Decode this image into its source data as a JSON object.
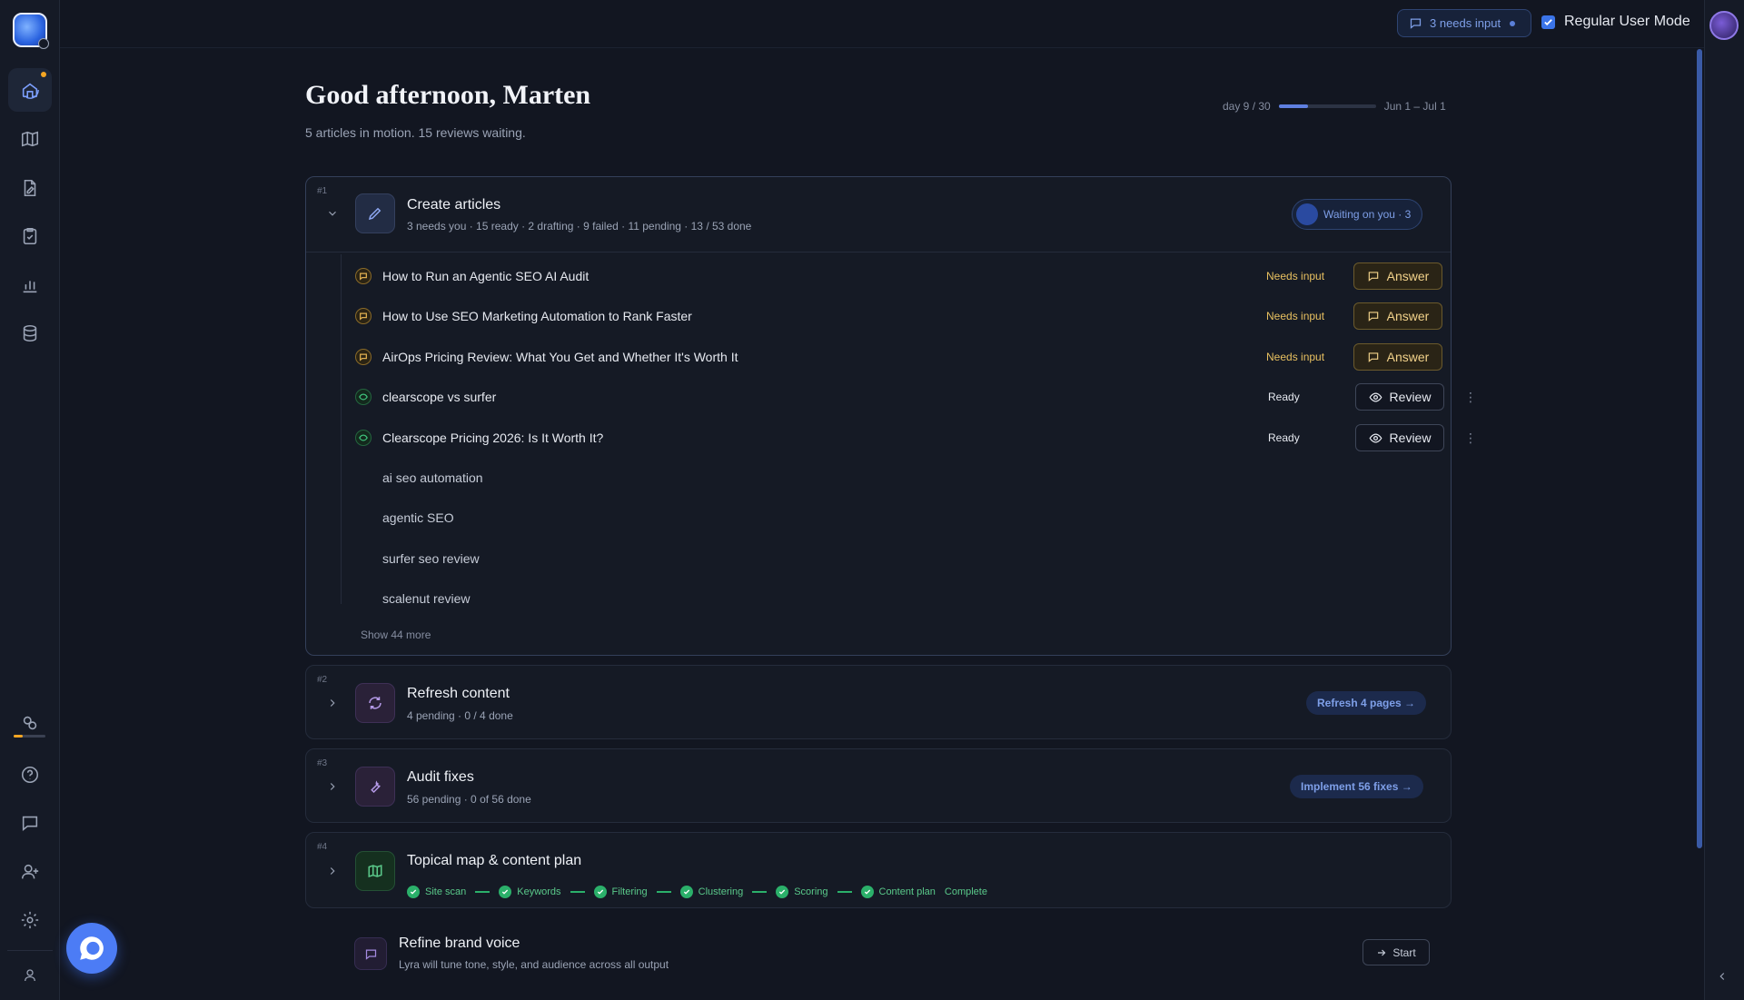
{
  "topbar": {
    "needs_input_label": "3 needs input",
    "mode_label": "Regular User Mode"
  },
  "main": {
    "greeting": "Good afternoon, Marten",
    "subtitle": "5 articles in motion. 15 reviews waiting.",
    "day_label": "day 9 / 30",
    "day_progress": 0.3,
    "date_range": "Jun 1 – Jul 1"
  },
  "cards": {
    "create": {
      "num": "#1",
      "title": "Create articles",
      "meta": "3 needs you · 15 ready · 2 drafting · 9 failed · 11 pending · 13 / 53 done",
      "badge": "Waiting on you · 3",
      "rows": [
        {
          "title": "How to Run an Agentic SEO AI Audit",
          "status": "Needs input",
          "action": "Answer"
        },
        {
          "title": "How to Use SEO Marketing Automation to Rank Faster",
          "status": "Needs input",
          "action": "Answer"
        },
        {
          "title": "AirOps Pricing Review: What You Get and Whether It's Worth It",
          "status": "Needs input",
          "action": "Answer"
        },
        {
          "title": "clearscope vs surfer",
          "status": "Ready",
          "action": "Review"
        },
        {
          "title": "Clearscope Pricing 2026: Is It Worth It?",
          "status": "Ready",
          "action": "Review"
        }
      ],
      "pending": [
        "ai seo automation",
        "agentic SEO",
        "surfer seo review",
        "scalenut review"
      ],
      "show_more": "Show 44 more"
    },
    "refresh": {
      "num": "#2",
      "title": "Refresh content",
      "meta": "4 pending · 0 / 4 done",
      "action": "Refresh 4 pages →"
    },
    "audit": {
      "num": "#3",
      "title": "Audit fixes",
      "meta": "56 pending · 0 of 56 done",
      "action": "Implement 56 fixes →"
    },
    "topical": {
      "num": "#4",
      "title": "Topical map & content plan",
      "steps": [
        "Site scan",
        "Keywords",
        "Filtering",
        "Clustering",
        "Scoring",
        "Content plan"
      ],
      "complete": "Complete"
    },
    "brand": {
      "title": "Refine brand voice",
      "meta": "Lyra will tune tone, style, and audience across all output",
      "action": "Start"
    }
  },
  "colors": {
    "accent": "#4c7cf5",
    "needs_input": "#f2d28a",
    "ready": "#2bb06a",
    "background": "#121621"
  }
}
